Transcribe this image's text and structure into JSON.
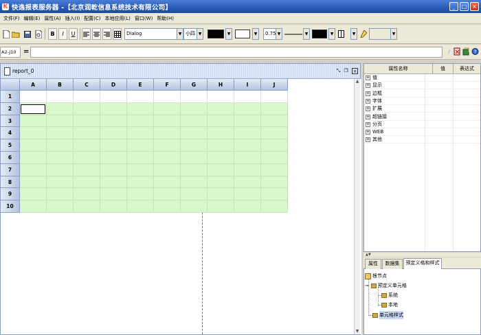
{
  "window": {
    "title": "快逸报表服务器 -【北京润乾信息系统技术有限公司】",
    "icon": "app-logo-icon",
    "controls": [
      "minimize-icon",
      "maximize-icon",
      "close-icon"
    ]
  },
  "menu": [
    {
      "label": "文件(F)"
    },
    {
      "label": "编辑(E)"
    },
    {
      "label": "属性(A)"
    },
    {
      "label": "插入(I)"
    },
    {
      "label": "配置(C)"
    },
    {
      "label": "本地应用(L)"
    },
    {
      "label": "窗口(W)"
    },
    {
      "label": "帮助(H)"
    }
  ],
  "toolbar": {
    "bold": "B",
    "italic": "I",
    "underline": "U",
    "font_family": "Dialog",
    "font_size": "小四",
    "line_width": "0.75",
    "fore_color": "#000000",
    "back_color": "#ffffff",
    "border_color": "#000000"
  },
  "formula": {
    "cell_ref": "A2-J10",
    "eq": "=",
    "value": ""
  },
  "sheet": {
    "name": "report_0",
    "columns": [
      "A",
      "B",
      "C",
      "D",
      "E",
      "F",
      "G",
      "H",
      "I",
      "J"
    ],
    "rows": [
      "1",
      "2",
      "3",
      "4",
      "5",
      "6",
      "7",
      "8",
      "9",
      "10"
    ],
    "selected_cell": "A2",
    "data_fill": "#d8f8cc"
  },
  "properties": {
    "headers": [
      "属性名称",
      "值",
      "表达式"
    ],
    "groups": [
      "值",
      "显示",
      "边框",
      "字体",
      "扩展",
      "超链接",
      "分页",
      "WEB",
      "其他"
    ]
  },
  "tabs": [
    {
      "label": "属性",
      "active": false
    },
    {
      "label": "数据集",
      "active": false
    },
    {
      "label": "预定义格和样式",
      "active": true
    }
  ],
  "tree": {
    "root": "根节点",
    "predef": "预定义单元格",
    "system": "系统",
    "local": "本地",
    "styles": "单元格样式"
  }
}
